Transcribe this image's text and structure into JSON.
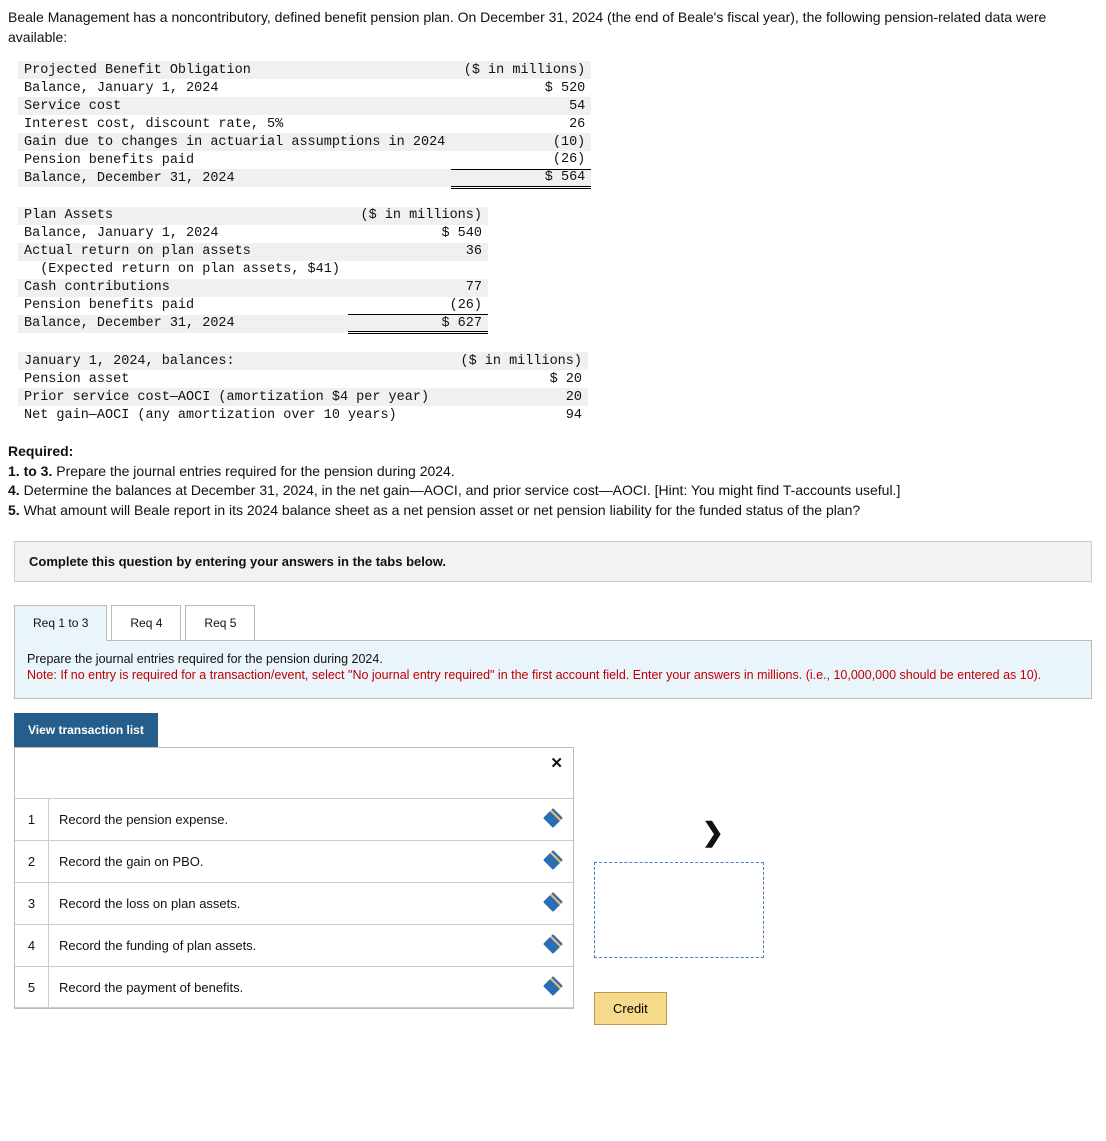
{
  "intro": "Beale Management has a noncontributory, defined benefit pension plan. On December 31, 2024 (the end of Beale's fiscal year), the following pension-related data were available:",
  "table1": {
    "header": "Projected Benefit Obligation",
    "unit": "($ in millions)",
    "rows": [
      {
        "label": "Balance, January 1, 2024",
        "value": "$ 520"
      },
      {
        "label": "Service cost",
        "value": "54"
      },
      {
        "label": "Interest cost, discount rate, 5%",
        "value": "26"
      },
      {
        "label": "Gain due to changes in actuarial assumptions in 2024",
        "value": "(10)"
      },
      {
        "label": "Pension benefits paid",
        "value": "(26)"
      }
    ],
    "total": {
      "label": "Balance, December 31, 2024",
      "value": "$ 564"
    }
  },
  "table2": {
    "header": "Plan Assets",
    "unit": "($ in millions)",
    "rows": [
      {
        "label": "Balance, January 1, 2024",
        "value": "$ 540"
      },
      {
        "label": "Actual return on plan assets",
        "value": "36"
      },
      {
        "label": "  (Expected return on plan assets, $41)",
        "value": ""
      },
      {
        "label": "Cash contributions",
        "value": "77"
      },
      {
        "label": "Pension benefits paid",
        "value": "(26)"
      }
    ],
    "total": {
      "label": "Balance, December 31, 2024",
      "value": "$ 627"
    }
  },
  "table3": {
    "header": "January 1, 2024, balances:",
    "unit": "($ in millions)",
    "rows": [
      {
        "label": "Pension asset",
        "value": "$ 20"
      },
      {
        "label": "Prior service cost—AOCI (amortization $4 per year)",
        "value": "20"
      },
      {
        "label": "Net gain—AOCI (any amortization over 10 years)",
        "value": "94"
      }
    ]
  },
  "required": {
    "heading": "Required:",
    "line1_bold": "1. to 3.",
    "line1": " Prepare the journal entries required for the pension during 2024.",
    "line2_bold": "4.",
    "line2": " Determine the balances at December 31, 2024, in the net gain—AOCI, and prior service cost—AOCI. [Hint: You might find T-accounts useful.]",
    "line3_bold": "5.",
    "line3": " What amount will Beale report in its 2024 balance sheet as a net pension asset or net pension liability for the funded status of the plan?"
  },
  "completeBar": "Complete this question by entering your answers in the tabs below.",
  "tabs": {
    "t1": "Req 1 to 3",
    "t2": "Req 4",
    "t3": "Req 5"
  },
  "tabContent": {
    "line1": "Prepare the journal entries required for the pension during 2024.",
    "note_prefix": "Note: ",
    "note": "If no entry is required for a transaction/event, select \"No journal entry required\" in the first account field. Enter your answers in millions. (i.e., 10,000,000 should be entered as 10)."
  },
  "viewBtn": "View transaction list",
  "closeSymbol": "✕",
  "transactions": [
    {
      "num": "1",
      "label": "Record the pension expense."
    },
    {
      "num": "2",
      "label": "Record the gain on PBO."
    },
    {
      "num": "3",
      "label": "Record the loss on plan assets."
    },
    {
      "num": "4",
      "label": "Record the funding of plan assets."
    },
    {
      "num": "5",
      "label": "Record the payment of benefits."
    }
  ],
  "chevron": "❯",
  "creditBtn": "Credit"
}
